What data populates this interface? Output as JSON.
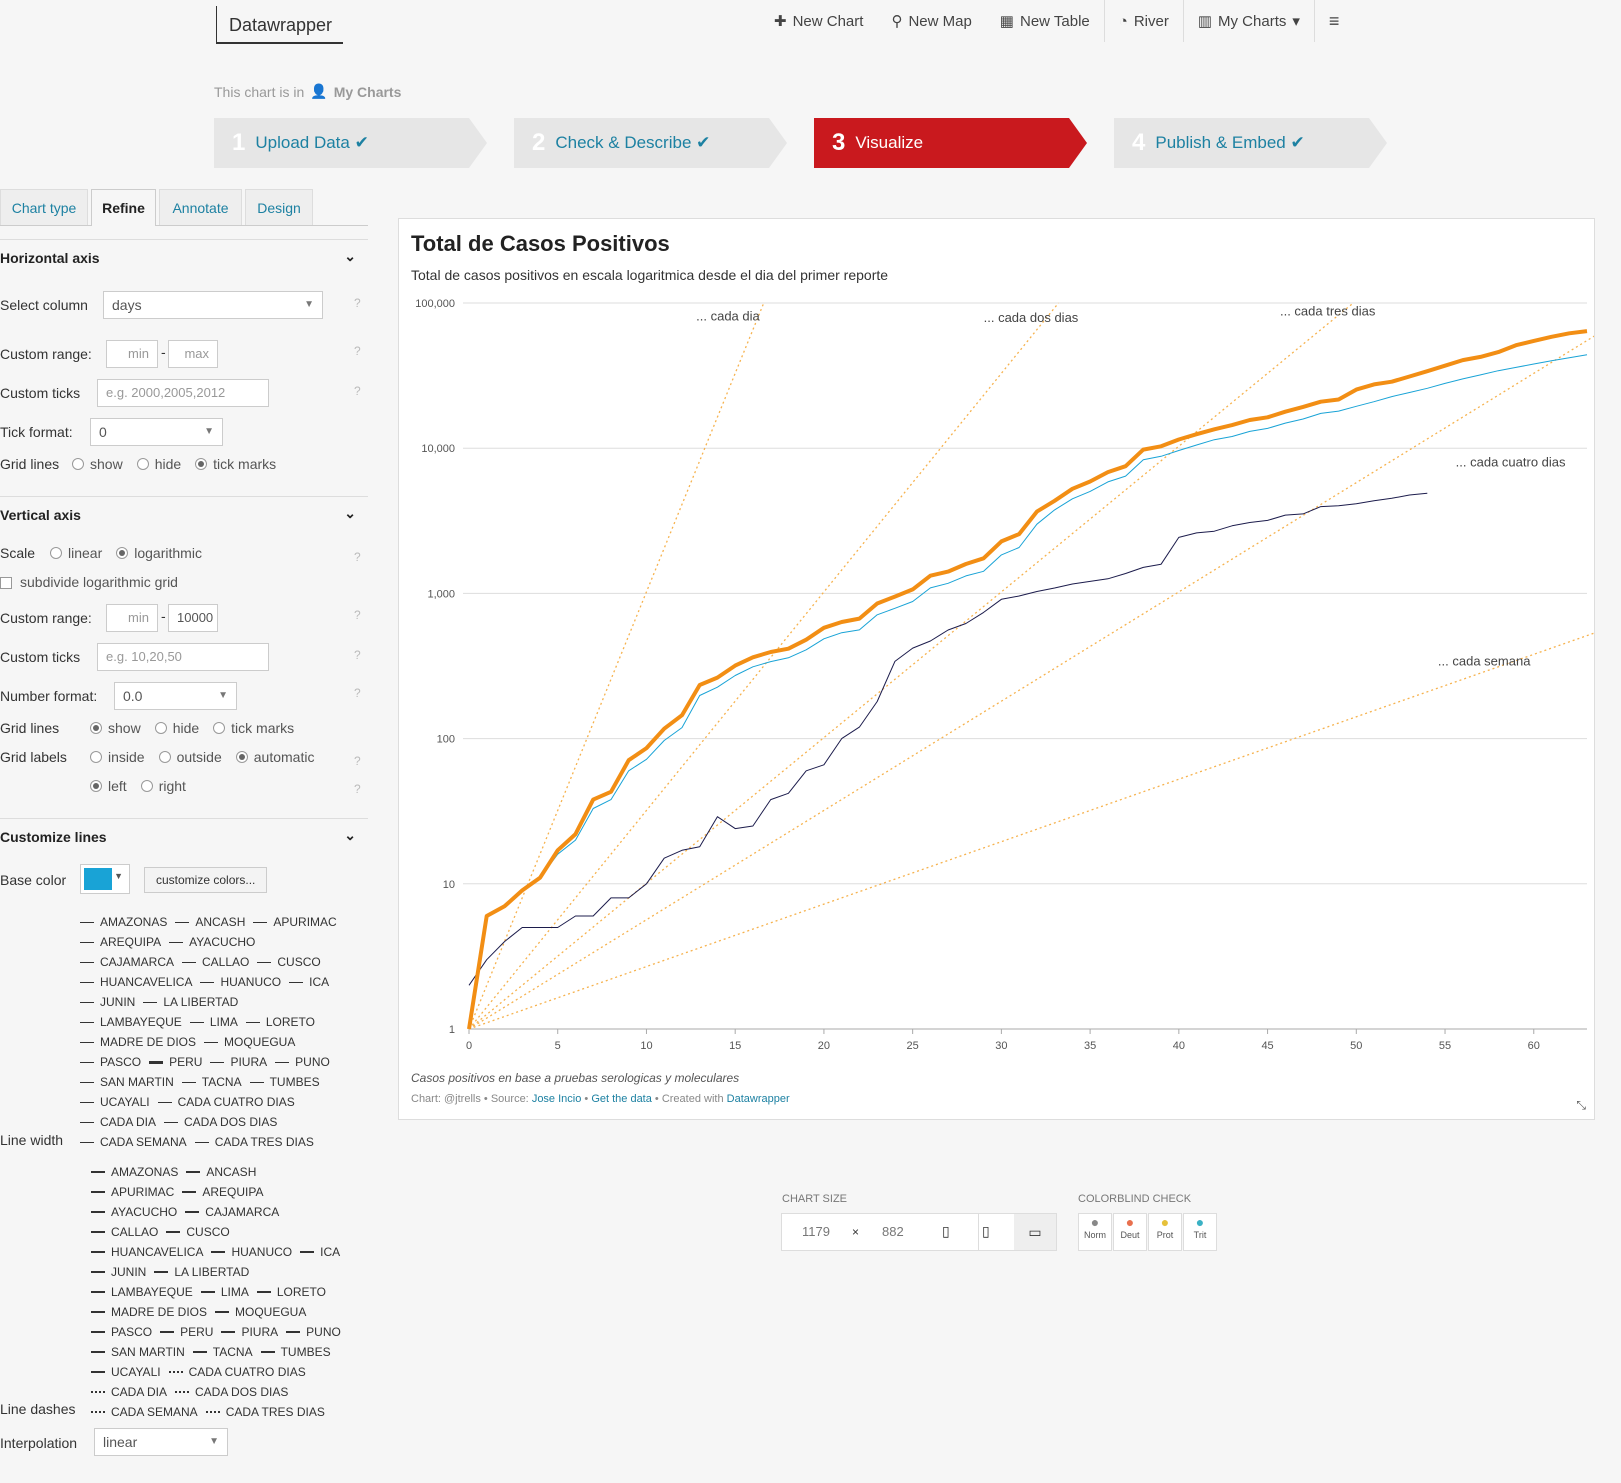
{
  "brand": "Datawrapper",
  "nav": {
    "new_chart": "New Chart",
    "new_map": "New Map",
    "new_table": "New Table",
    "river": "River",
    "my_charts": "My Charts"
  },
  "crumb": {
    "prefix": "This chart is in",
    "folder": "My Charts"
  },
  "steps": [
    {
      "num": "1",
      "label": "Upload Data"
    },
    {
      "num": "2",
      "label": "Check & Describe"
    },
    {
      "num": "3",
      "label": "Visualize"
    },
    {
      "num": "4",
      "label": "Publish & Embed"
    }
  ],
  "tabs": [
    "Chart type",
    "Refine",
    "Annotate",
    "Design"
  ],
  "horizontal": {
    "title": "Horizontal axis",
    "select_column_label": "Select column",
    "select_column_value": "days",
    "custom_range_label": "Custom range:",
    "min_placeholder": "min",
    "max_placeholder": "max",
    "custom_ticks_label": "Custom ticks",
    "custom_ticks_placeholder": "e.g. 2000,2005,2012",
    "tick_format_label": "Tick format:",
    "tick_format_value": "0",
    "grid_lines_label": "Grid lines",
    "grid_opts": [
      "show",
      "hide",
      "tick marks"
    ]
  },
  "vertical": {
    "title": "Vertical axis",
    "scale_label": "Scale",
    "scale_opts": [
      "linear",
      "logarithmic"
    ],
    "subdivide_label": "subdivide logarithmic grid",
    "custom_range_label": "Custom range:",
    "min_placeholder": "min",
    "max_value": "10000",
    "custom_ticks_label": "Custom ticks",
    "custom_ticks_placeholder": "e.g. 10,20,50",
    "number_format_label": "Number format:",
    "number_format_value": "0.0",
    "grid_lines_label": "Grid lines",
    "grid_opts": [
      "show",
      "hide",
      "tick marks"
    ],
    "grid_labels_label": "Grid labels",
    "grid_label_opts": [
      "inside",
      "outside",
      "automatic"
    ],
    "side_opts": [
      "left",
      "right"
    ]
  },
  "lines": {
    "title": "Customize lines",
    "base_color_label": "Base color",
    "base_color": "#19a3d6",
    "customize_btn": "customize colors...",
    "line_width_label": "Line width",
    "line_dashes_label": "Line dashes",
    "interpolation_label": "Interpolation",
    "interpolation_value": "linear",
    "color_legend_rows": [
      [
        "AMAZONAS",
        "ANCASH",
        "APURIMAC"
      ],
      [
        "AREQUIPA",
        "AYACUCHO"
      ],
      [
        "CAJAMARCA",
        "CALLAO",
        "CUSCO"
      ],
      [
        "HUANCAVELICA",
        "HUANUCO",
        "ICA"
      ],
      [
        "JUNIN",
        "LA LIBERTAD"
      ],
      [
        "LAMBAYEQUE",
        "LIMA",
        "LORETO"
      ],
      [
        "MADRE DE DIOS",
        "MOQUEGUA"
      ],
      [
        "PASCO",
        "PERU",
        "PIURA",
        "PUNO"
      ],
      [
        "SAN MARTIN",
        "TACNA",
        "TUMBES"
      ],
      [
        "UCAYALI",
        "CADA CUATRO DIAS"
      ],
      [
        "CADA DIA",
        "CADA DOS DIAS"
      ],
      [
        "CADA SEMANA",
        "CADA TRES DIAS"
      ]
    ],
    "width_legend_rows": [
      [
        "AMAZONAS",
        "ANCASH"
      ],
      [
        "APURIMAC",
        "AREQUIPA"
      ],
      [
        "AYACUCHO",
        "CAJAMARCA"
      ],
      [
        "CALLAO",
        "CUSCO"
      ],
      [
        "HUANCAVELICA",
        "HUANUCO",
        "ICA"
      ],
      [
        "JUNIN",
        "LA LIBERTAD"
      ],
      [
        "LAMBAYEQUE",
        "LIMA",
        "LORETO"
      ],
      [
        "MADRE DE DIOS",
        "MOQUEGUA"
      ],
      [
        "PASCO",
        "PERU",
        "PIURA",
        "PUNO"
      ],
      [
        "SAN MARTIN",
        "TACNA",
        "TUMBES"
      ],
      [
        "UCAYALI",
        "CADA CUATRO DIAS"
      ],
      [
        "CADA DIA",
        "CADA DOS DIAS"
      ],
      [
        "CADA SEMANA",
        "CADA TRES DIAS"
      ]
    ]
  },
  "chart_size": {
    "label": "CHART SIZE",
    "width": "1179",
    "x": "×",
    "height": "882"
  },
  "colorblind": {
    "label": "COLORBLIND CHECK",
    "opts": [
      "Norm",
      "Deut",
      "Prot",
      "Trit"
    ]
  },
  "chart_data": {
    "type": "line",
    "title": "Total de Casos Positivos",
    "subtitle": "Total de casos positivos en escala logaritmica desde el dia del primer reporte",
    "note": "Casos positivos en base a pruebas serologicas y moleculares",
    "footer": {
      "chart_by": "Chart: @jtrells",
      "source_label": "Source:",
      "source": "Jose Incio",
      "get_data": "Get the data",
      "created": "Created with",
      "tool": "Datawrapper"
    },
    "x_ticks": [
      0,
      5,
      10,
      15,
      20,
      25,
      30,
      35,
      40,
      45,
      50,
      55,
      60
    ],
    "y_ticks": [
      1,
      10,
      100,
      1000,
      10000,
      100000
    ],
    "y_tick_labels": [
      "1",
      "10",
      "100",
      "1,000",
      "10,000",
      "100,000"
    ],
    "y_scale": "logarithmic",
    "xlim": [
      0,
      63
    ],
    "ylim": [
      1,
      100000
    ],
    "annotations": [
      "... cada dia",
      "... cada dos dias",
      "... cada tres dias",
      "... cada cuatro dias",
      "... cada semana"
    ],
    "series": [
      {
        "name": "PERU",
        "color": "#f28e14",
        "width": 4,
        "x": [
          0,
          1,
          2,
          3,
          4,
          5,
          6,
          7,
          8,
          9,
          10,
          11,
          12,
          13,
          14,
          15,
          16,
          17,
          18,
          19,
          20,
          21,
          22,
          23,
          24,
          25,
          26,
          27,
          28,
          29,
          30,
          31,
          32,
          33,
          34,
          35,
          36,
          37,
          38,
          39,
          40,
          41,
          42,
          43,
          44,
          45,
          46,
          47,
          48,
          49,
          50,
          51,
          52,
          53,
          54,
          55,
          56,
          57,
          58,
          59,
          60,
          61,
          62,
          63
        ],
        "y": [
          1,
          6,
          7,
          9,
          11,
          17,
          22,
          38,
          43,
          71,
          86,
          117,
          145,
          234,
          263,
          318,
          363,
          395,
          416,
          480,
          580,
          635,
          671,
          852,
          950,
          1065,
          1323,
          1414,
          1595,
          1746,
          2281,
          2561,
          3660,
          4342,
          5256,
          5897,
          6848,
          7519,
          9784,
          10303,
          11475,
          12491,
          13489,
          14420,
          15628,
          16325,
          17837,
          19250,
          20914,
          21648,
          25331,
          27517,
          28699,
          31190,
          33931,
          36976,
          40459,
          42534,
          45928,
          51189,
          54817,
          58526,
          61847,
          64000
        ]
      },
      {
        "name": "LIMA",
        "color": "#19a3d6",
        "width": 1,
        "x": [
          2,
          3,
          4,
          5,
          6,
          7,
          8,
          9,
          10,
          11,
          12,
          13,
          14,
          15,
          16,
          17,
          18,
          19,
          20,
          21,
          22,
          23,
          24,
          25,
          26,
          27,
          28,
          29,
          30,
          31,
          32,
          33,
          34,
          35,
          36,
          37,
          38,
          39,
          40,
          41,
          42,
          43,
          44,
          45,
          46,
          47,
          48,
          49,
          50,
          51,
          52,
          53,
          54,
          55,
          56,
          57,
          58,
          59,
          60,
          61,
          62,
          63
        ],
        "y": [
          7,
          9,
          11,
          16,
          20,
          33,
          38,
          60,
          72,
          97,
          119,
          198,
          226,
          272,
          312,
          339,
          360,
          409,
          487,
          536,
          561,
          712,
          790,
          880,
          1092,
          1174,
          1320,
          1420,
          1840,
          2072,
          2998,
          3757,
          4482,
          5040,
          5857,
          6420,
          8320,
          8800,
          9640,
          10520,
          11450,
          12040,
          13050,
          13680,
          14890,
          15880,
          17370,
          18000,
          19430,
          20900,
          22670,
          24180,
          25860,
          27960,
          30000,
          32000,
          34200,
          36000,
          38000,
          40000,
          42000,
          44000
        ]
      },
      {
        "name": "LORETO",
        "color": "#1c1c4c",
        "width": 1,
        "x": [
          0,
          1,
          2,
          3,
          4,
          5,
          6,
          7,
          8,
          9,
          10,
          11,
          12,
          13,
          14,
          15,
          16,
          17,
          18,
          19,
          20,
          21,
          22,
          23,
          24,
          25,
          26,
          27,
          28,
          29,
          30,
          31,
          32,
          33,
          34,
          35,
          36,
          37,
          38,
          39,
          40,
          41,
          42,
          43,
          44,
          45,
          46,
          47,
          48,
          49,
          50,
          51,
          52,
          53,
          54
        ],
        "y": [
          2,
          3,
          4,
          5,
          5,
          5,
          6,
          6,
          8,
          8,
          10,
          15,
          17,
          18,
          29,
          24,
          25,
          38,
          42,
          60,
          66,
          100,
          120,
          180,
          340,
          420,
          470,
          560,
          620,
          740,
          910,
          960,
          1030,
          1090,
          1160,
          1210,
          1260,
          1370,
          1510,
          1590,
          2430,
          2610,
          2680,
          2920,
          3080,
          3180,
          3460,
          3530,
          3960,
          4010,
          4150,
          4340,
          4520,
          4760,
          4900
        ]
      }
    ],
    "legend": "none",
    "grid": "horizontal"
  }
}
